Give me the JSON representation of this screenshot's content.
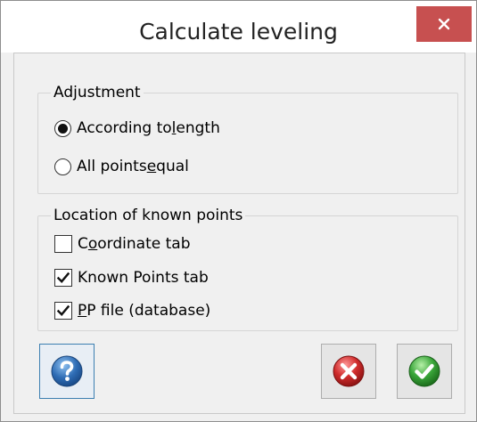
{
  "window": {
    "title": "Calculate leveling",
    "close_glyph": "×"
  },
  "adjustment": {
    "legend": "Adjustment",
    "options": [
      {
        "before": "According to ",
        "underline": "l",
        "after": "ength",
        "selected": true
      },
      {
        "before": "All points ",
        "underline": "e",
        "after": "qual",
        "selected": false
      }
    ]
  },
  "location": {
    "legend": "Location of known points",
    "items": [
      {
        "before": "C",
        "underline": "o",
        "after": "ordinate tab",
        "checked": false
      },
      {
        "before": "",
        "underline": "",
        "after": "Known Points tab",
        "checked": true
      },
      {
        "before": "",
        "underline": "P",
        "after": "P file (database)",
        "checked": true
      }
    ]
  },
  "buttons": {
    "help_icon": "question-icon",
    "cancel_icon": "red-x-icon",
    "ok_icon": "green-check-icon"
  },
  "colors": {
    "close_bg": "#c75050",
    "help_blue": "#2f6db5",
    "cancel_red": "#d02c2c",
    "ok_green": "#3aa63a"
  }
}
